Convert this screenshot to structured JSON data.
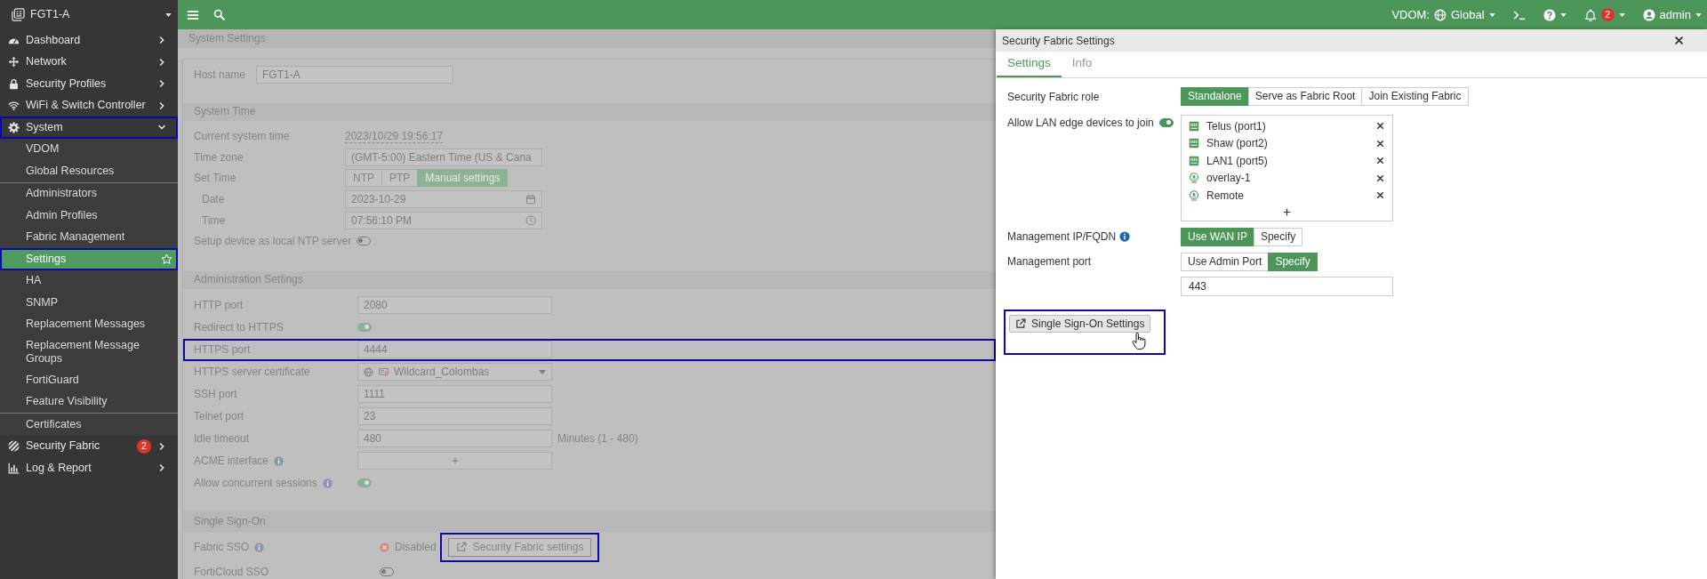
{
  "sidebar": {
    "device": "FGT1-A",
    "items": [
      {
        "label": "Dashboard",
        "selected": false,
        "expanded": false,
        "highlighted": false
      },
      {
        "label": "Network",
        "selected": false,
        "expanded": false,
        "highlighted": false
      },
      {
        "label": "Security Profiles",
        "selected": false,
        "expanded": false,
        "highlighted": false
      },
      {
        "label": "WiFi & Switch Controller",
        "selected": false,
        "expanded": false,
        "highlighted": false
      },
      {
        "label": "System",
        "selected": false,
        "expanded": true,
        "highlighted": true,
        "groups": [
          {
            "children": [
              {
                "label": "VDOM",
                "selected": false,
                "highlighted": false
              },
              {
                "label": "Global Resources",
                "selected": false,
                "highlighted": false
              }
            ]
          },
          {
            "children": [
              {
                "label": "Administrators",
                "selected": false,
                "highlighted": false
              },
              {
                "label": "Admin Profiles",
                "selected": false,
                "highlighted": false
              },
              {
                "label": "Fabric Management",
                "selected": false,
                "highlighted": false
              },
              {
                "label": "Settings",
                "selected": true,
                "highlighted": true
              },
              {
                "label": "HA",
                "selected": false,
                "highlighted": false
              },
              {
                "label": "SNMP",
                "selected": false,
                "highlighted": false
              },
              {
                "label": "Replacement Messages",
                "selected": false,
                "highlighted": false
              },
              {
                "label": "Replacement Message Groups",
                "selected": false,
                "highlighted": false
              },
              {
                "label": "FortiGuard",
                "selected": false,
                "highlighted": false
              },
              {
                "label": "Feature Visibility",
                "selected": false,
                "highlighted": false
              }
            ]
          },
          {
            "children": [
              {
                "label": "Certificates",
                "selected": false,
                "highlighted": false
              }
            ]
          }
        ]
      },
      {
        "label": "Security Fabric",
        "selected": false,
        "expanded": false,
        "highlighted": false,
        "badge": "2"
      },
      {
        "label": "Log & Report",
        "selected": false,
        "expanded": false,
        "highlighted": false
      }
    ]
  },
  "topbar": {
    "vdom_label": "VDOM:",
    "vdom": "Global",
    "notifications": "2",
    "user": "admin"
  },
  "settings_page": {
    "breadcrumb": "System Settings",
    "host_name": {
      "label": "Host name",
      "value": "FGT1-A"
    },
    "sections": [
      {
        "title": "System Time",
        "rows": [
          {
            "kind": "text",
            "label": "Current system time",
            "info": false,
            "highlighted": false,
            "value": "2023/10/29 19:56:17"
          },
          {
            "kind": "select",
            "label": "Time zone",
            "info": false,
            "highlighted": false,
            "value": "(GMT-5:00) Eastern Time (US & Cana"
          },
          {
            "kind": "segmented",
            "label": "Set Time",
            "info": false,
            "highlighted": false,
            "options": [
              {
                "label": "NTP",
                "selected": false
              },
              {
                "label": "PTP",
                "selected": false
              },
              {
                "label": "Manual settings",
                "selected": true
              }
            ],
            "children": [
              {
                "kind": "date",
                "label": "Date",
                "info": false,
                "highlighted": false,
                "value": "2023-10-29"
              },
              {
                "kind": "time",
                "label": "Time",
                "info": false,
                "highlighted": false,
                "value": "07:56:10 PM"
              }
            ]
          },
          {
            "kind": "toggle",
            "label": "Setup device as local NTP server",
            "info": false,
            "highlighted": false,
            "on": false
          }
        ]
      },
      {
        "title": "Administration Settings",
        "rows": [
          {
            "kind": "input",
            "label": "HTTP port",
            "info": false,
            "highlighted": false,
            "value": "2080"
          },
          {
            "kind": "toggle",
            "label": "Redirect to HTTPS",
            "info": false,
            "highlighted": false,
            "on": true
          },
          {
            "kind": "input",
            "label": "HTTPS port",
            "info": false,
            "highlighted": true,
            "value": "4444"
          },
          {
            "kind": "certificate",
            "label": "HTTPS server certificate",
            "info": false,
            "highlighted": false,
            "value": "Wildcard_Colombas"
          },
          {
            "kind": "input",
            "label": "SSH port",
            "info": false,
            "highlighted": false,
            "value": "1111"
          },
          {
            "kind": "input",
            "label": "Telnet port",
            "info": false,
            "highlighted": false,
            "value": "23"
          },
          {
            "kind": "input",
            "label": "Idle timeout",
            "info": false,
            "highlighted": false,
            "value": "480",
            "suffix": "Minutes (1 - 480)"
          },
          {
            "kind": "add",
            "label": "ACME interface",
            "info": true,
            "highlighted": false
          },
          {
            "kind": "toggle",
            "label": "Allow concurrent sessions",
            "info": true,
            "highlighted": false,
            "on": true
          }
        ]
      },
      {
        "title": "Single Sign-On",
        "rows": [
          {
            "kind": "status",
            "label": "Fabric SSO",
            "info": true,
            "highlighted": true,
            "status": "Disabled",
            "button": "Security Fabric settings"
          },
          {
            "kind": "toggle",
            "label": "FortiCloud SSO",
            "info": false,
            "highlighted": false,
            "on": false
          }
        ]
      }
    ]
  },
  "panel": {
    "title": "Security Fabric Settings",
    "tabs": [
      {
        "label": "Settings",
        "selected": true
      },
      {
        "label": "Info",
        "selected": false
      }
    ],
    "rows": [
      {
        "kind": "segmented",
        "label": "Security Fabric role",
        "info": false,
        "options": [
          {
            "label": "Standalone",
            "selected": true
          },
          {
            "label": "Serve as Fabric Root",
            "selected": false
          },
          {
            "label": "Join Existing Fabric",
            "selected": false
          }
        ]
      },
      {
        "kind": "device_list",
        "label": "Allow LAN edge devices to join",
        "info": false,
        "on": true,
        "devices": [
          {
            "name": "Telus (port1)",
            "kind": "port"
          },
          {
            "name": "Shaw (port2)",
            "kind": "port"
          },
          {
            "name": "LAN1 (port5)",
            "kind": "port"
          },
          {
            "name": "overlay-1",
            "kind": "tunnel"
          },
          {
            "name": "Remote",
            "kind": "tunnel"
          }
        ]
      },
      {
        "kind": "segmented",
        "label": "Management IP/FQDN",
        "info": true,
        "options": [
          {
            "label": "Use WAN IP",
            "selected": true
          },
          {
            "label": "Specify",
            "selected": false
          }
        ]
      },
      {
        "kind": "segmented",
        "label": "Management port",
        "info": false,
        "options": [
          {
            "label": "Use Admin Port",
            "selected": false
          },
          {
            "label": "Specify",
            "selected": true
          }
        ],
        "value": "443"
      }
    ],
    "sso_button": {
      "label": "Single Sign-On Settings",
      "highlighted": true
    }
  }
}
